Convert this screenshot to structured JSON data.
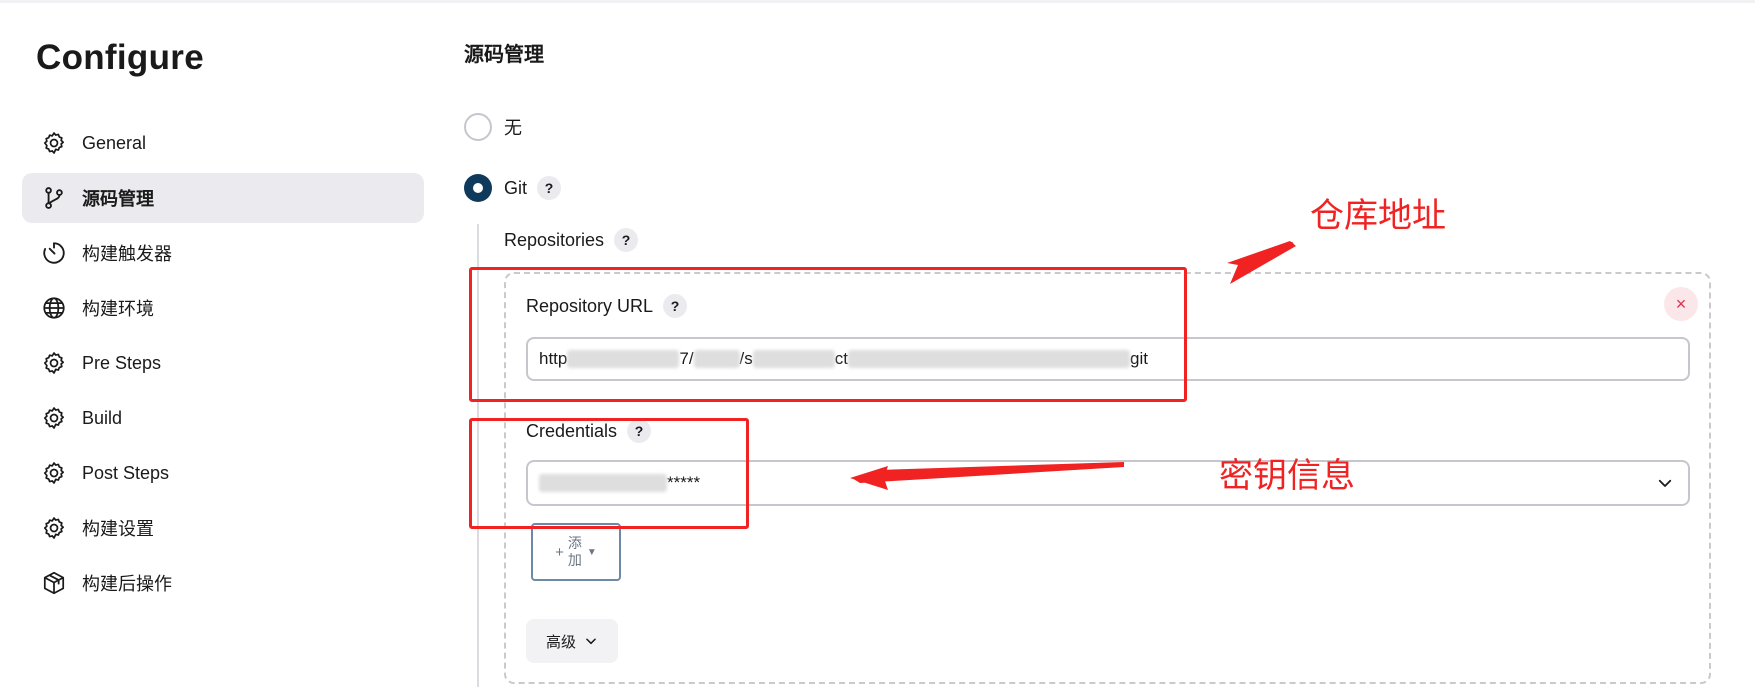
{
  "sidebar": {
    "title": "Configure",
    "items": [
      {
        "label": "General",
        "icon": "gear-icon",
        "active": false
      },
      {
        "label": "源码管理",
        "icon": "git-branch-icon",
        "active": true
      },
      {
        "label": "构建触发器",
        "icon": "timer-icon",
        "active": false
      },
      {
        "label": "构建环境",
        "icon": "globe-icon",
        "active": false
      },
      {
        "label": "Pre Steps",
        "icon": "gear-icon",
        "active": false
      },
      {
        "label": "Build",
        "icon": "gear-icon",
        "active": false
      },
      {
        "label": "Post Steps",
        "icon": "gear-icon",
        "active": false
      },
      {
        "label": "构建设置",
        "icon": "gear-icon",
        "active": false
      },
      {
        "label": "构建后操作",
        "icon": "package-icon",
        "active": false
      }
    ]
  },
  "main": {
    "section_title": "源码管理",
    "scm_options": [
      {
        "label": "无",
        "checked": false
      },
      {
        "label": "Git",
        "checked": true,
        "help": "?"
      }
    ],
    "repositories_label": "Repositories",
    "repository_url_label": "Repository URL",
    "repository_url_value_parts": [
      "http",
      "7/",
      "/s",
      "ct",
      "git"
    ],
    "credentials_label": "Credentials",
    "credentials_value_suffix": "*****",
    "add_button_plus": "+",
    "add_button_label": "添加",
    "advanced_button_label": "高级",
    "help_glyph": "?",
    "close_glyph": "×"
  },
  "annotations": {
    "repo_address": "仓库地址",
    "key_info": "密钥信息",
    "color": "#f02222"
  },
  "colors": {
    "active_bg": "#ebebef",
    "radio_checked": "#0f3a5c",
    "close_red": "#e0314b"
  }
}
